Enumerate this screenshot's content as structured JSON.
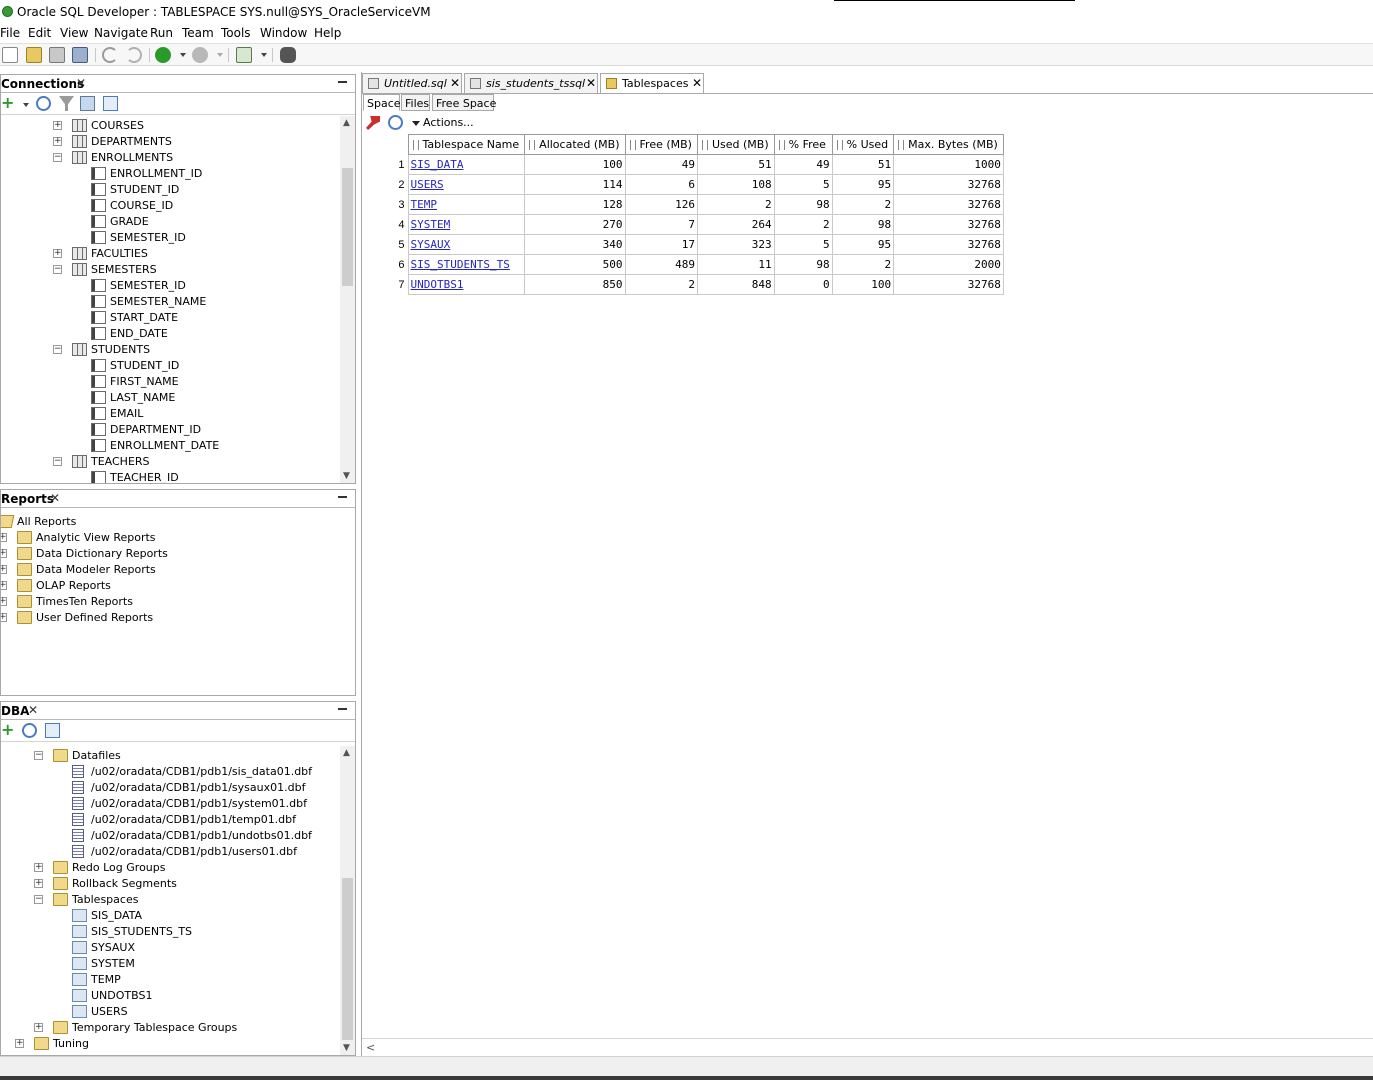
{
  "window": {
    "title": "Oracle SQL Developer : TABLESPACE SYS.null@SYS_OracleServiceVM"
  },
  "menu": [
    "File",
    "Edit",
    "View",
    "Navigate",
    "Run",
    "Team",
    "Tools",
    "Window",
    "Help"
  ],
  "toolbar": {
    "icons": [
      "new-icon",
      "open-icon",
      "save-icon",
      "save-all-icon",
      "undo-icon",
      "redo-icon",
      "run-icon",
      "stop-icon",
      "sql-worksheet-icon",
      "binoculars-icon"
    ]
  },
  "connections": {
    "title": "Connections",
    "tree": [
      {
        "label": "COURSES",
        "type": "table",
        "level": 1,
        "exp": "+"
      },
      {
        "label": "DEPARTMENTS",
        "type": "table",
        "level": 1,
        "exp": "+"
      },
      {
        "label": "ENROLLMENTS",
        "type": "table",
        "level": 1,
        "exp": "-"
      },
      {
        "label": "ENROLLMENT_ID",
        "type": "column",
        "level": 2
      },
      {
        "label": "STUDENT_ID",
        "type": "column",
        "level": 2
      },
      {
        "label": "COURSE_ID",
        "type": "column",
        "level": 2
      },
      {
        "label": "GRADE",
        "type": "column",
        "level": 2
      },
      {
        "label": "SEMESTER_ID",
        "type": "column",
        "level": 2
      },
      {
        "label": "FACULTIES",
        "type": "table",
        "level": 1,
        "exp": "+"
      },
      {
        "label": "SEMESTERS",
        "type": "table",
        "level": 1,
        "exp": "-"
      },
      {
        "label": "SEMESTER_ID",
        "type": "column",
        "level": 2
      },
      {
        "label": "SEMESTER_NAME",
        "type": "column",
        "level": 2
      },
      {
        "label": "START_DATE",
        "type": "column",
        "level": 2
      },
      {
        "label": "END_DATE",
        "type": "column",
        "level": 2
      },
      {
        "label": "STUDENTS",
        "type": "table",
        "level": 1,
        "exp": "-"
      },
      {
        "label": "STUDENT_ID",
        "type": "column",
        "level": 2
      },
      {
        "label": "FIRST_NAME",
        "type": "column",
        "level": 2
      },
      {
        "label": "LAST_NAME",
        "type": "column",
        "level": 2
      },
      {
        "label": "EMAIL",
        "type": "column",
        "level": 2
      },
      {
        "label": "DEPARTMENT_ID",
        "type": "column",
        "level": 2
      },
      {
        "label": "ENROLLMENT_DATE",
        "type": "column",
        "level": 2
      },
      {
        "label": "TEACHERS",
        "type": "table",
        "level": 1,
        "exp": "-"
      },
      {
        "label": "TEACHER_ID",
        "type": "column",
        "level": 2
      }
    ]
  },
  "reports": {
    "title": "Reports",
    "tree": [
      {
        "label": "All Reports",
        "type": "report-root",
        "level": 0
      },
      {
        "label": "Analytic View Reports",
        "type": "folder",
        "level": 1,
        "exp": "+"
      },
      {
        "label": "Data Dictionary Reports",
        "type": "folder",
        "level": 1,
        "exp": "+"
      },
      {
        "label": "Data Modeler Reports",
        "type": "folder",
        "level": 1,
        "exp": "+"
      },
      {
        "label": "OLAP Reports",
        "type": "folder",
        "level": 1,
        "exp": "+"
      },
      {
        "label": "TimesTen Reports",
        "type": "folder",
        "level": 1,
        "exp": "+"
      },
      {
        "label": "User Defined Reports",
        "type": "folder",
        "level": 1,
        "exp": "+"
      }
    ]
  },
  "dba": {
    "title": "DBA",
    "tree": [
      {
        "label": "Datafiles",
        "type": "folder",
        "level": 1,
        "exp": "-"
      },
      {
        "label": "/u02/oradata/CDB1/pdb1/sis_data01.dbf",
        "type": "file",
        "level": 2
      },
      {
        "label": "/u02/oradata/CDB1/pdb1/sysaux01.dbf",
        "type": "file",
        "level": 2
      },
      {
        "label": "/u02/oradata/CDB1/pdb1/system01.dbf",
        "type": "file",
        "level": 2
      },
      {
        "label": "/u02/oradata/CDB1/pdb1/temp01.dbf",
        "type": "file",
        "level": 2
      },
      {
        "label": "/u02/oradata/CDB1/pdb1/undotbs01.dbf",
        "type": "file",
        "level": 2
      },
      {
        "label": "/u02/oradata/CDB1/pdb1/users01.dbf",
        "type": "file",
        "level": 2
      },
      {
        "label": "Redo Log Groups",
        "type": "folder",
        "level": 1,
        "exp": "+"
      },
      {
        "label": "Rollback Segments",
        "type": "folder",
        "level": 1,
        "exp": "+"
      },
      {
        "label": "Tablespaces",
        "type": "folder",
        "level": 1,
        "exp": "-"
      },
      {
        "label": "SIS_DATA",
        "type": "ts",
        "level": 2
      },
      {
        "label": "SIS_STUDENTS_TS",
        "type": "ts",
        "level": 2
      },
      {
        "label": "SYSAUX",
        "type": "ts",
        "level": 2
      },
      {
        "label": "SYSTEM",
        "type": "ts",
        "level": 2
      },
      {
        "label": "TEMP",
        "type": "ts",
        "level": 2
      },
      {
        "label": "UNDOTBS1",
        "type": "ts",
        "level": 2
      },
      {
        "label": "USERS",
        "type": "ts",
        "level": 2
      },
      {
        "label": "Temporary Tablespace Groups",
        "type": "folder",
        "level": 1,
        "exp": "+"
      },
      {
        "label": "Tuning",
        "type": "folder",
        "level": 0,
        "exp": "+"
      }
    ]
  },
  "editor": {
    "tabs": [
      {
        "label": "Untitled.sql",
        "italic": true
      },
      {
        "label": "sis_students_tssql",
        "italic": true
      },
      {
        "label": "Tablespaces",
        "italic": false
      }
    ],
    "subtabs": [
      "Space",
      "Files",
      "Free Space"
    ],
    "actions_label": "Actions...",
    "columns": [
      "Tablespace Name",
      "Allocated (MB)",
      "Free (MB)",
      "Used (MB)",
      "% Free",
      "% Used",
      "Max. Bytes (MB)"
    ],
    "rows": [
      [
        "1",
        "SIS_DATA",
        "100",
        "49",
        "51",
        "49",
        "51",
        "1000"
      ],
      [
        "2",
        "USERS",
        "114",
        "6",
        "108",
        "5",
        "95",
        "32768"
      ],
      [
        "3",
        "TEMP",
        "128",
        "126",
        "2",
        "98",
        "2",
        "32768"
      ],
      [
        "4",
        "SYSTEM",
        "270",
        "7",
        "264",
        "2",
        "98",
        "32768"
      ],
      [
        "5",
        "SYSAUX",
        "340",
        "17",
        "323",
        "5",
        "95",
        "32768"
      ],
      [
        "6",
        "SIS_STUDENTS_TS",
        "500",
        "489",
        "11",
        "98",
        "2",
        "2000"
      ],
      [
        "7",
        "UNDOTBS1",
        "850",
        "2",
        "848",
        "0",
        "100",
        "32768"
      ]
    ]
  }
}
